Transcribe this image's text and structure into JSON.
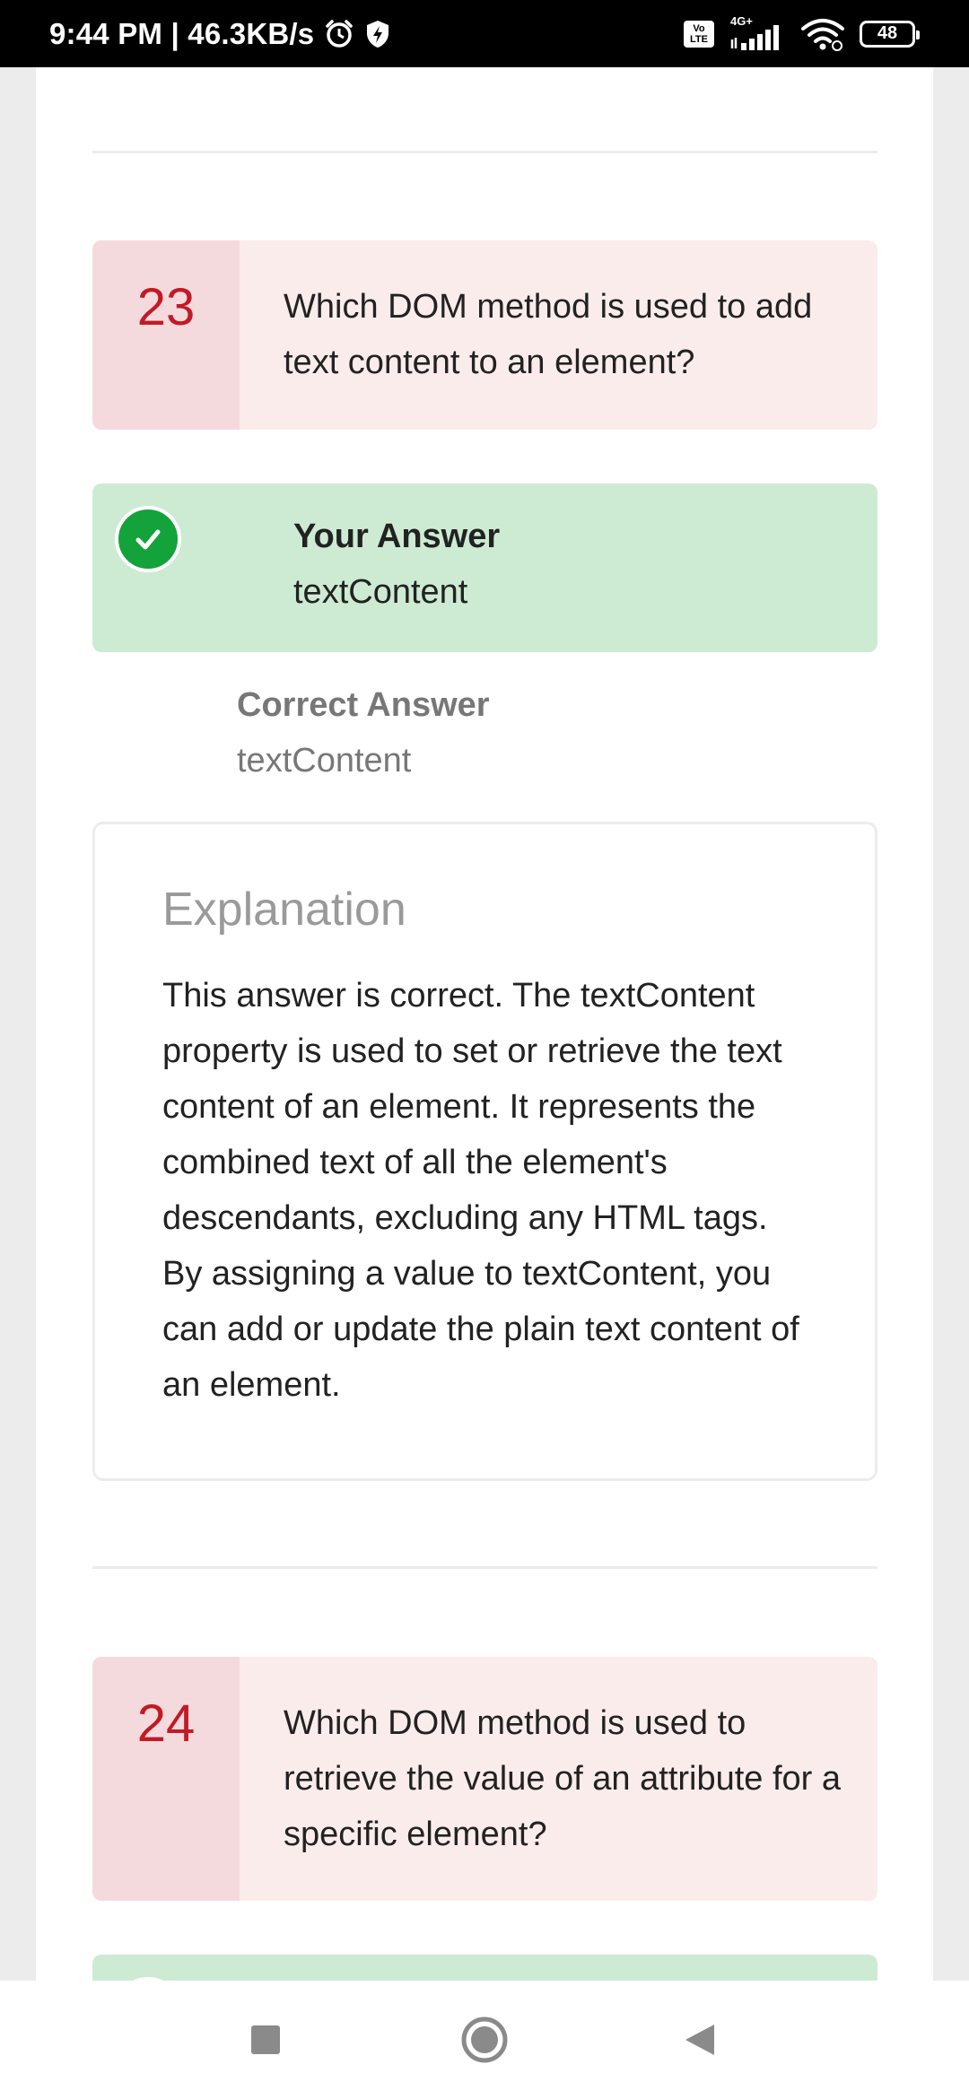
{
  "status_bar": {
    "time_speed": "9:44 PM | 46.3KB/s",
    "network_badge": "Vo LTE",
    "signal_label": "4G+",
    "battery": "48",
    "icons": [
      "alarm-icon",
      "shield-icon",
      "volte-icon",
      "signal-icon",
      "wifi-icon",
      "battery-icon"
    ]
  },
  "questions": [
    {
      "number": "23",
      "text": "Which DOM method is used to add text content to an element?",
      "your_answer_label": "Your Answer",
      "your_answer": "textContent",
      "correct_answer_label": "Correct Answer",
      "correct_answer": "textContent",
      "explanation_title": "Explanation",
      "explanation": "This answer is correct. The textContent property is used to set or retrieve the text content of an element. It represents the combined text of all the element's descendants, excluding any HTML tags. By assigning a value to textContent, you can add or update the plain text content of an element."
    },
    {
      "number": "24",
      "text": "Which DOM method is used to retrieve the value of an attribute for a specific element?"
    }
  ],
  "colors": {
    "question_bg": "#fbecec",
    "question_number_bg": "#f5dadd",
    "question_number": "#c11b26",
    "answer_bg": "#cdebd3",
    "check": "#14a23a"
  },
  "nav": {
    "icons": [
      "recents-square-icon",
      "home-circle-icon",
      "back-triangle-icon"
    ]
  }
}
